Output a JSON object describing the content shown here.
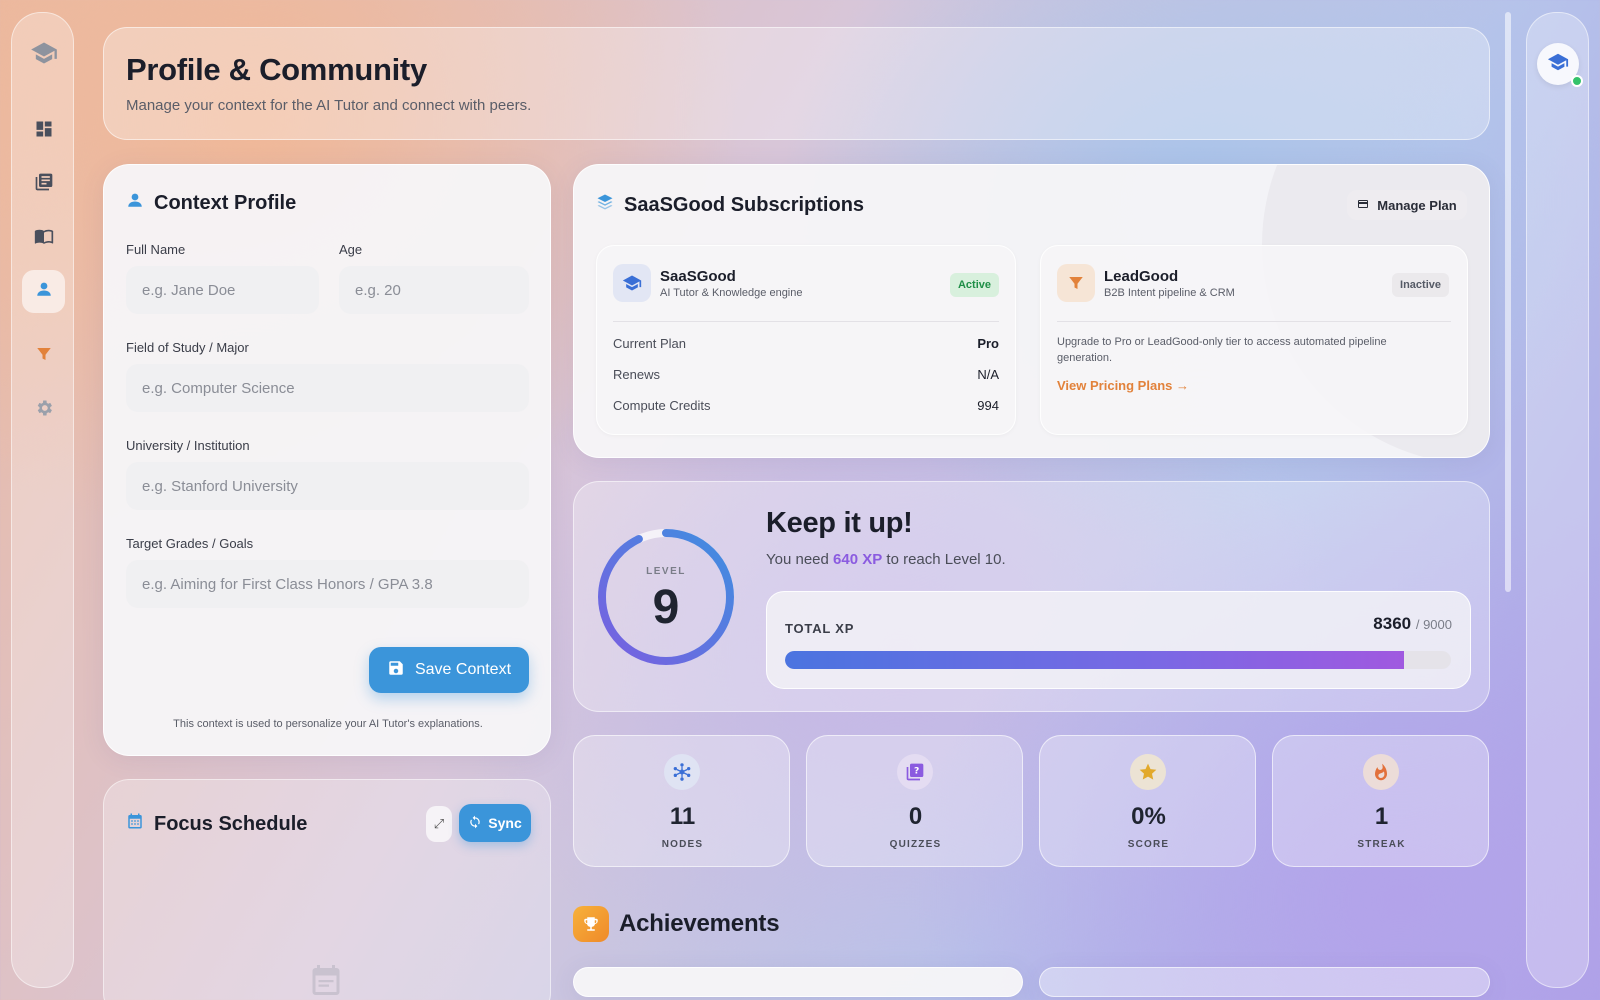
{
  "header": {
    "title": "Profile & Community",
    "subtitle": "Manage your context for the AI Tutor and connect with peers."
  },
  "nav": {
    "items": [
      "dashboard-icon",
      "library-icon",
      "book-icon",
      "user-icon",
      "funnel-icon",
      "gear-icon"
    ],
    "active": "user-icon"
  },
  "context_profile": {
    "title": "Context Profile",
    "full_name_label": "Full Name",
    "full_name_placeholder": "e.g. Jane Doe",
    "age_label": "Age",
    "age_placeholder": "e.g. 20",
    "field_label": "Field of Study / Major",
    "field_placeholder": "e.g. Computer Science",
    "university_label": "University / Institution",
    "university_placeholder": "e.g. Stanford University",
    "goals_label": "Target Grades / Goals",
    "goals_placeholder": "e.g. Aiming for First Class Honors / GPA 3.8",
    "save_label": "Save Context",
    "note": "This context is used to personalize your AI Tutor's explanations."
  },
  "focus_schedule": {
    "title": "Focus Schedule",
    "sync_label": "Sync"
  },
  "subscriptions": {
    "title": "SaaSGood Subscriptions",
    "manage_label": "Manage Plan",
    "saasgood": {
      "name": "SaaSGood",
      "desc": "AI Tutor & Knowledge engine",
      "status": "Active",
      "plan_label": "Current Plan",
      "plan_value": "Pro",
      "renews_label": "Renews",
      "renews_value": "N/A",
      "credits_label": "Compute Credits",
      "credits_value": "994"
    },
    "leadgood": {
      "name": "LeadGood",
      "desc": "B2B Intent pipeline & CRM",
      "status": "Inactive",
      "upgrade_text": "Upgrade to Pro or LeadGood-only tier to access automated pipeline generation.",
      "pricing_link": "View Pricing Plans →"
    }
  },
  "level": {
    "label": "LEVEL",
    "value": "9",
    "progress_fraction": 0.93,
    "headline": "Keep it up!",
    "need_prefix": "You need ",
    "need_xp": "640 XP",
    "need_suffix": " to reach Level 10.",
    "total_label": "TOTAL XP",
    "total_value": "8360",
    "total_max": "/ 9000",
    "xp_current": 8360,
    "xp_max": 9000
  },
  "stats": [
    {
      "value": "11",
      "label": "NODES",
      "icon": "network-icon"
    },
    {
      "value": "0",
      "label": "QUIZZES",
      "icon": "quiz-icon"
    },
    {
      "value": "0%",
      "label": "SCORE",
      "icon": "star-icon"
    },
    {
      "value": "1",
      "label": "STREAK",
      "icon": "flame-icon"
    }
  ],
  "achievements": {
    "title": "Achievements"
  },
  "colors": {
    "primary": "#3b95da",
    "accent_purple": "#8b5be0",
    "orange": "#e2823b",
    "active_green": "#33c26b"
  }
}
